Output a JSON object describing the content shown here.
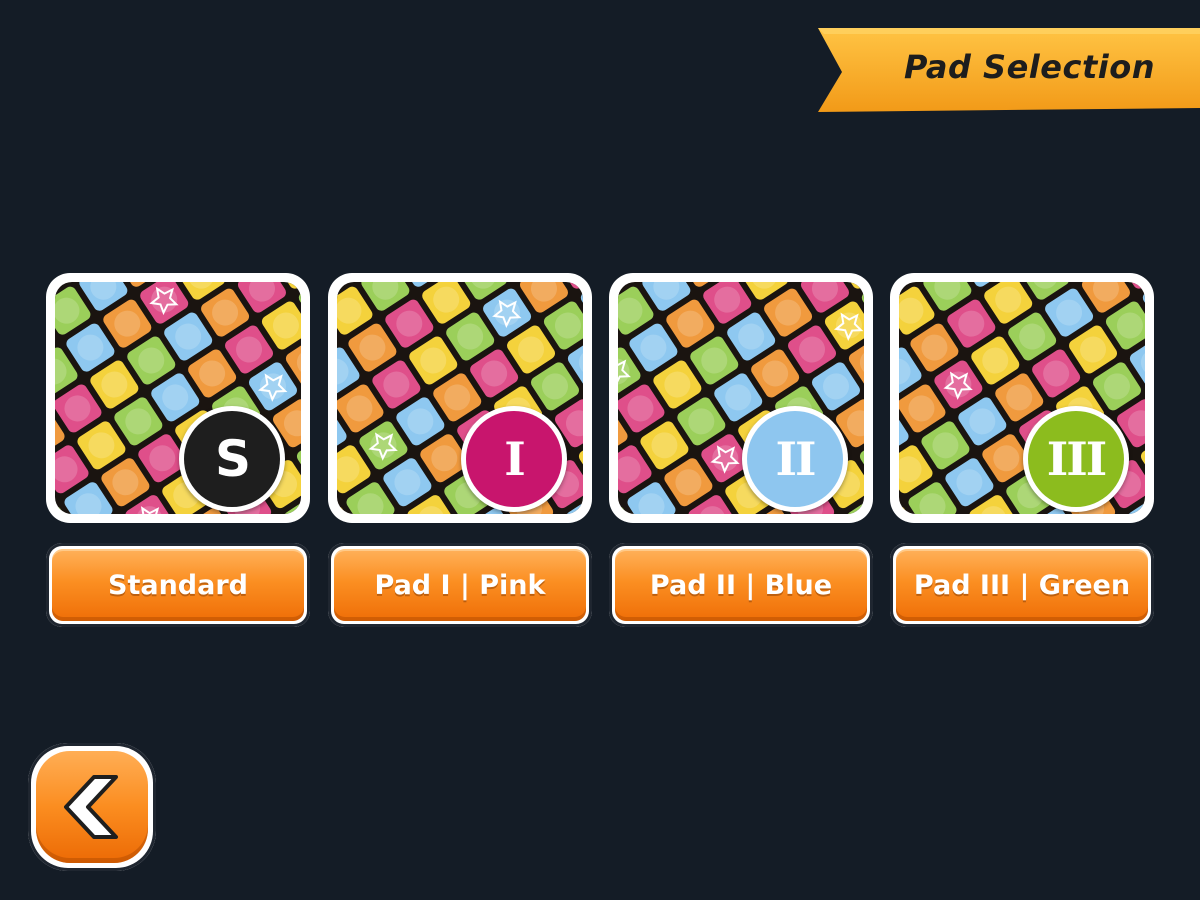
{
  "header": {
    "title": "Pad Selection",
    "ribbon_color": "#f6a824"
  },
  "pads": [
    {
      "badge": "S",
      "label": "Standard",
      "badge_color": "#1e1e1e"
    },
    {
      "badge": "I",
      "label": "Pad I | Pink",
      "badge_color": "#c8156d"
    },
    {
      "badge": "II",
      "label": "Pad II | Blue",
      "badge_color": "#8ec6ef"
    },
    {
      "badge": "III",
      "label": "Pad III | Green",
      "badge_color": "#8cbc1e"
    }
  ],
  "tile_palette": [
    "#f4d23c",
    "#f09a3e",
    "#9bcf5a",
    "#df4f8a",
    "#8ec8f0"
  ],
  "back_button": {
    "icon": "back-arrow-icon",
    "color": "#f98c1f"
  }
}
